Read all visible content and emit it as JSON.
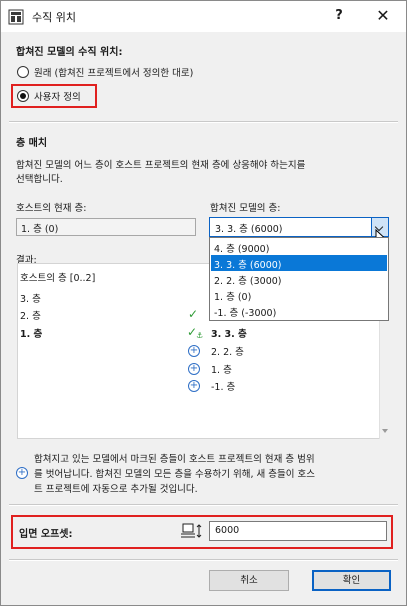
{
  "window": {
    "title": "수직 위치",
    "help_glyph": "?",
    "close_glyph": "✕"
  },
  "vertical_position": {
    "heading": "합쳐진 모델의 수직 위치:",
    "options": [
      {
        "label": "원래 (합쳐진 프로젝트에서 정의한 대로)",
        "selected": false
      },
      {
        "label": "사용자 정의",
        "selected": true
      }
    ]
  },
  "story_match": {
    "heading": "층 매치",
    "description_lines": [
      "합쳐진 모델의 어느 층이 호스트 프로젝트의 현재 층에 상응해야 하는지를",
      "선택합니다."
    ],
    "host_label": "호스트의 현재 층:",
    "host_value": "1. 층 (0)",
    "merged_label": "합쳐진 모델의 층:",
    "merged_value": "3. 3. 층 (6000)",
    "dropdown_items": [
      {
        "label": "4. 층 (9000)",
        "selected": false
      },
      {
        "label": "3. 3. 층 (6000)",
        "selected": true
      },
      {
        "label": "2. 2. 층 (3000)",
        "selected": false
      },
      {
        "label": "1. 층 (0)",
        "selected": false
      },
      {
        "label": "-1. 층 (-3000)",
        "selected": false
      }
    ]
  },
  "result": {
    "label": "결과:",
    "host_range": "호스트의 층 [0..2]",
    "host_stories": [
      {
        "label": "3. 층",
        "bold": false
      },
      {
        "label": "2. 층",
        "bold": false
      },
      {
        "label": "1. 층",
        "bold": true
      }
    ],
    "merged_stories": [
      {
        "label": "3. 3. 층",
        "bold": true,
        "icon": "check-anchor-icon"
      },
      {
        "label": "2. 2. 층",
        "bold": false,
        "icon": "plus-circle-icon"
      },
      {
        "label": "1. 층",
        "bold": false,
        "icon": "plus-circle-icon"
      },
      {
        "label": "-1. 층",
        "bold": false,
        "icon": "plus-circle-icon"
      }
    ]
  },
  "note": {
    "lines": [
      "합쳐지고 있는 모델에서 마크된 층들이 호스트 프로젝트의 현재 층 범위",
      "를 벗어납니다. 합쳐진 모델의 모든 층을 수용하기 위해, 새 층들이 호스",
      "트 프로젝트에 자동으로 추가될 것입니다."
    ]
  },
  "elevation": {
    "label": "입면 오프셋:",
    "value": "6000"
  },
  "buttons": {
    "cancel": "취소",
    "ok": "확인"
  },
  "colors": {
    "highlight_box": "#e0201f",
    "selection": "#0a78d7",
    "check": "#2e9b36",
    "plus": "#2f6fc6"
  }
}
